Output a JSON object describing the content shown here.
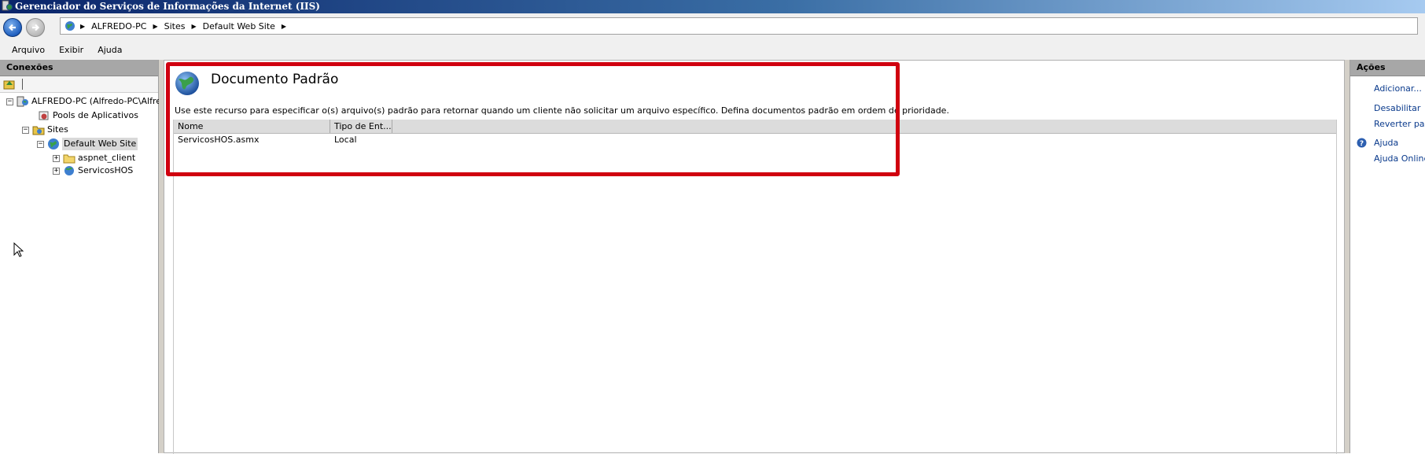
{
  "window": {
    "title": "Gerenciador do Serviços de Informações da Internet (IIS)"
  },
  "address": {
    "crumbs": [
      "ALFREDO-PC",
      "Sites",
      "Default Web Site"
    ]
  },
  "menu": {
    "items": [
      "Arquivo",
      "Exibir",
      "Ajuda"
    ]
  },
  "connections": {
    "header": "Conexões",
    "tree": {
      "server": "ALFREDO-PC (Alfredo-PC\\Alfred",
      "app_pools": "Pools de Aplicativos",
      "sites": "Sites",
      "default_site": "Default Web Site",
      "children": [
        "aspnet_client",
        "ServicosHOS"
      ]
    }
  },
  "main": {
    "title": "Documento Padrão",
    "description": "Use este recurso para especificar o(s) arquivo(s) padrão para retornar quando um cliente não solicitar um arquivo específico. Defina documentos padrão em ordem de prioridade.",
    "columns": [
      "Nome",
      "Tipo de Ent..."
    ],
    "rows": [
      {
        "name": "ServicosHOS.asmx",
        "type": "Local"
      }
    ]
  },
  "actions": {
    "header": "Ações",
    "add": "Adicionar...",
    "disable": "Desabilitar",
    "revert": "Reverter para",
    "help": "Ajuda",
    "online_help": "Ajuda Online"
  },
  "colors": {
    "highlight": "#d0000f",
    "link": "#0a3a8c",
    "panel_header": "#a7a7a7"
  }
}
